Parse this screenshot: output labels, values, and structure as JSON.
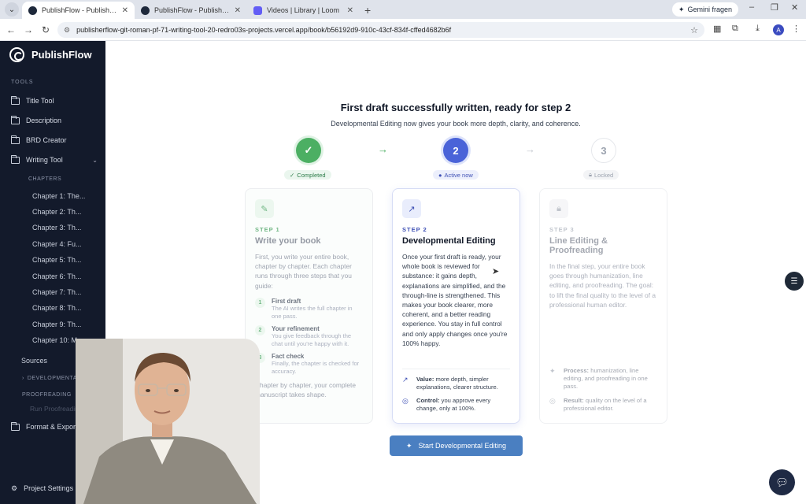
{
  "browser": {
    "tabs": [
      {
        "title": "PublishFlow - Publish Your First",
        "icon": "publishflow-favicon",
        "active": true
      },
      {
        "title": "PublishFlow - Publish Your First",
        "icon": "publishflow-favicon",
        "active": false
      },
      {
        "title": "Videos | Library | Loom",
        "icon": "loom-favicon",
        "active": false
      }
    ],
    "gemini_label": "Gemini fragen",
    "url": "publisherflow-git-roman-pf-71-writing-tool-20-redro03s-projects.vercel.app/book/b56192d9-910c-43cf-834f-cffed4682b6f",
    "profile_initial": "A"
  },
  "sidebar": {
    "brand": "PublishFlow",
    "tools_label": "TOOLS",
    "items": [
      "Title Tool",
      "Description",
      "BRD Creator",
      "Writing Tool"
    ],
    "chapters_label": "CHAPTERS",
    "chapters": [
      "Chapter 1: The...",
      "Chapter 2: Th...",
      "Chapter 3: Th...",
      "Chapter 4: Fu...",
      "Chapter 5: Th...",
      "Chapter 6: Th...",
      "Chapter 7: Th...",
      "Chapter 8: Th...",
      "Chapter 9: Th...",
      "Chapter 10: M..."
    ],
    "sources": "Sources",
    "developmental": "DEVELOPMENTAL ...",
    "proofreading": "PROOFREADING",
    "run_proofreading": "Run Proofreading",
    "format_export": "Format & Export",
    "project_settings": "Project Settings"
  },
  "main": {
    "title": "First draft successfully written, ready for step 2",
    "subtitle": "Developmental Editing now gives your book more depth, clarity, and coherence.",
    "steps": [
      {
        "num": "✓",
        "badge": "Completed",
        "state": "completed"
      },
      {
        "num": "2",
        "badge": "Active now",
        "state": "active"
      },
      {
        "num": "3",
        "badge": "Locked",
        "state": "locked"
      }
    ],
    "cards": [
      {
        "label": "STEP 1",
        "title": "Write your book",
        "body": "First, you write your entire book, chapter by chapter. Each chapter runs through three steps that you guide:",
        "substeps": [
          {
            "n": "1",
            "title": "First draft",
            "desc": "The AI writes the full chapter in one pass."
          },
          {
            "n": "2",
            "title": "Your refinement",
            "desc": "You give feedback through the chat until you're happy with it."
          },
          {
            "n": "3",
            "title": "Fact check",
            "desc": "Finally, the chapter is checked for accuracy."
          }
        ],
        "footer": "Chapter by chapter, your complete manuscript takes shape."
      },
      {
        "label": "STEP 2",
        "title": "Developmental Editing",
        "body": "Once your first draft is ready, your whole book is reviewed for substance: it gains depth, explanations are simplified, and the through-line is strengthened. This makes your book clearer, more coherent, and a better reading experience. You stay in full control and only apply changes once you're 100% happy.",
        "meta": [
          {
            "key": "Value:",
            "val": "more depth, simpler explanations, clearer structure."
          },
          {
            "key": "Control:",
            "val": "you approve every change, only at 100%."
          }
        ]
      },
      {
        "label": "STEP 3",
        "title": "Line Editing & Proofreading",
        "body": "In the final step, your entire book goes through humanization, line editing, and proofreading. The goal: to lift the final quality to the level of a professional human editor.",
        "meta": [
          {
            "key": "Process:",
            "val": "humanization, line editing, and proofreading in one pass."
          },
          {
            "key": "Result:",
            "val": "quality on the level of a professional editor."
          }
        ]
      }
    ],
    "cta": "Start Developmental Editing"
  },
  "colors": {
    "active": "#4a63d8",
    "completed": "#4caf63",
    "cta": "#4a7fc1",
    "sidebar": "#131a2b"
  }
}
